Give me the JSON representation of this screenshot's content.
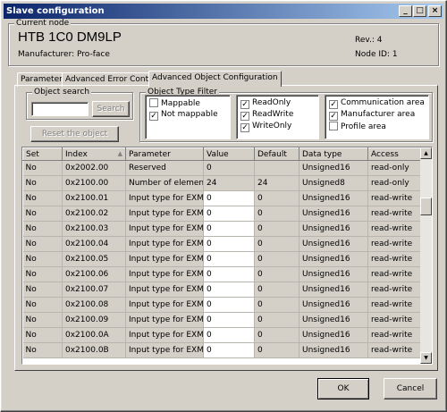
{
  "window": {
    "title": "Slave configuration",
    "controls": {
      "minimize": "_",
      "maximize": "□",
      "close": "×"
    }
  },
  "node": {
    "group_label": "Current node",
    "name": "HTB 1C0 DM9LP",
    "manufacturer": "Manufacturer: Pro-face",
    "rev": "Rev.: 4",
    "node_id": "Node ID: 1"
  },
  "tabs": [
    {
      "label": "Parameters"
    },
    {
      "label": "Advanced Error Control"
    },
    {
      "label": "Advanced Object Configuration",
      "active": true
    }
  ],
  "object_search": {
    "label": "Object search",
    "value": "",
    "search_button": "Search",
    "reset_button": "Reset the object"
  },
  "filter": {
    "label": "Object Type Filter",
    "map_opts": [
      {
        "label": "Mappable",
        "checked": false
      },
      {
        "label": "Not mappable",
        "checked": true
      }
    ],
    "access_opts": [
      {
        "label": "ReadOnly",
        "checked": true
      },
      {
        "label": "ReadWrite",
        "checked": true
      },
      {
        "label": "WriteOnly",
        "checked": true
      }
    ],
    "area_opts": [
      {
        "label": "Communication area",
        "checked": true
      },
      {
        "label": "Manufacturer area",
        "checked": true
      },
      {
        "label": "Profile area",
        "checked": false
      }
    ]
  },
  "table": {
    "columns": [
      "Set",
      "Index",
      "Parameter",
      "Value",
      "Default",
      "Data type",
      "Access"
    ],
    "sort_indicator": "▲",
    "rows": [
      [
        "No",
        "0x2002.00",
        "Reserved",
        "0",
        "",
        "Unsigned16",
        "read-only"
      ],
      [
        "No",
        "0x2100.00",
        "Number of elements",
        "24",
        "24",
        "Unsigned8",
        "read-only"
      ],
      [
        "No",
        "0x2100.01",
        "Input type for EXM ...",
        "0",
        "0",
        "Unsigned16",
        "read-write"
      ],
      [
        "No",
        "0x2100.02",
        "Input type for EXM ...",
        "0",
        "0",
        "Unsigned16",
        "read-write"
      ],
      [
        "No",
        "0x2100.03",
        "Input type for EXM ...",
        "0",
        "0",
        "Unsigned16",
        "read-write"
      ],
      [
        "No",
        "0x2100.04",
        "Input type for EXM ...",
        "0",
        "0",
        "Unsigned16",
        "read-write"
      ],
      [
        "No",
        "0x2100.05",
        "Input type for EXM ...",
        "0",
        "0",
        "Unsigned16",
        "read-write"
      ],
      [
        "No",
        "0x2100.06",
        "Input type for EXM ...",
        "0",
        "0",
        "Unsigned16",
        "read-write"
      ],
      [
        "No",
        "0x2100.07",
        "Input type for EXM ...",
        "0",
        "0",
        "Unsigned16",
        "read-write"
      ],
      [
        "No",
        "0x2100.08",
        "Input type for EXM ...",
        "0",
        "0",
        "Unsigned16",
        "read-write"
      ],
      [
        "No",
        "0x2100.09",
        "Input type for EXM ...",
        "0",
        "0",
        "Unsigned16",
        "read-write"
      ],
      [
        "No",
        "0x2100.0A",
        "Input type for EXM ...",
        "0",
        "0",
        "Unsigned16",
        "read-write"
      ],
      [
        "No",
        "0x2100.0B",
        "Input type for EXM ...",
        "0",
        "0",
        "Unsigned16",
        "read-write"
      ]
    ]
  },
  "buttons": {
    "ok": "OK",
    "cancel": "Cancel"
  },
  "colors": {
    "title_start": "#0a246a",
    "title_end": "#a6caf0",
    "face": "#d4d0c8"
  }
}
